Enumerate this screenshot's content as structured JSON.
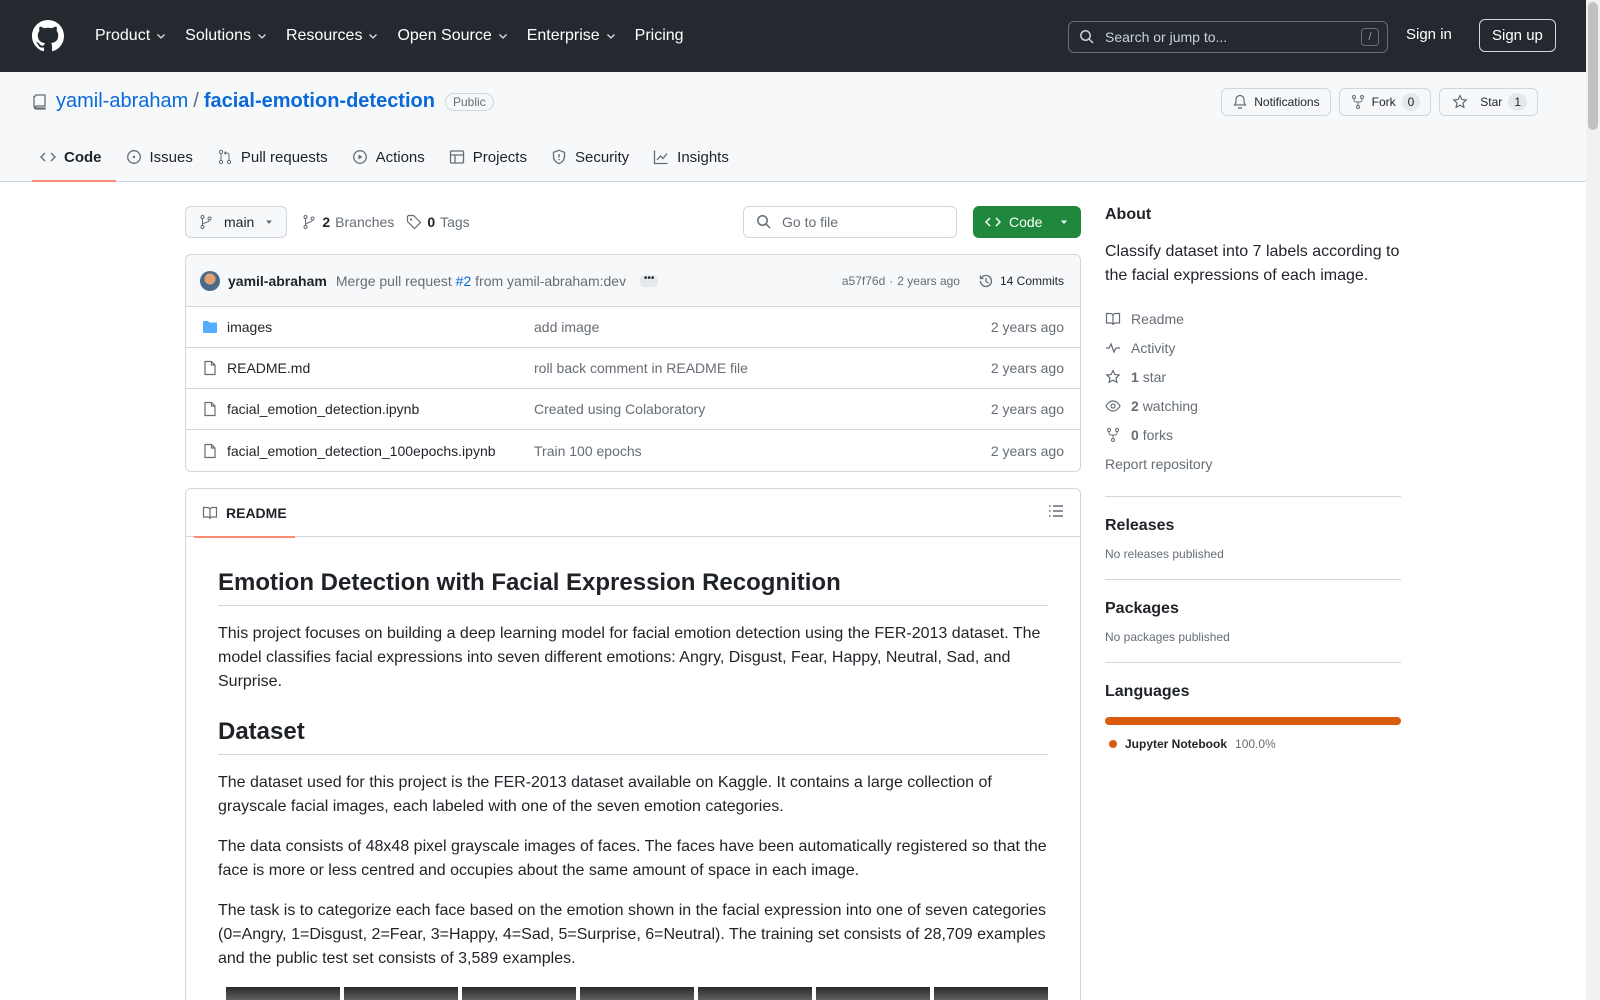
{
  "header": {
    "nav": [
      "Product",
      "Solutions",
      "Resources",
      "Open Source",
      "Enterprise",
      "Pricing"
    ],
    "search_placeholder": "Search or jump to...",
    "search_shortcut": "/",
    "sign_in": "Sign in",
    "sign_up": "Sign up"
  },
  "repo": {
    "owner": "yamil-abraham",
    "separator": "/",
    "name": "facial-emotion-detection",
    "visibility": "Public",
    "notifications_label": "Notifications",
    "fork_label": "Fork",
    "fork_count": "0",
    "star_label": "Star",
    "star_count": "1",
    "tabs": [
      "Code",
      "Issues",
      "Pull requests",
      "Actions",
      "Projects",
      "Security",
      "Insights"
    ]
  },
  "file_nav": {
    "branch": "main",
    "branches_count": "2",
    "branches_label": "Branches",
    "tags_count": "0",
    "tags_label": "Tags",
    "goto_placeholder": "Go to file",
    "code_button": "Code"
  },
  "commit": {
    "author": "yamil-abraham",
    "message_prefix": "Merge pull request",
    "pr_link": "#2",
    "message_suffix": "from yamil-abraham:dev",
    "hash": "a57f76d",
    "dot": "·",
    "age": "2 years ago",
    "commits_label": "14 Commits"
  },
  "files": [
    {
      "name": "images",
      "type": "folder",
      "message": "add image",
      "age": "2 years ago"
    },
    {
      "name": "README.md",
      "type": "file",
      "message": "roll back comment in README file",
      "age": "2 years ago"
    },
    {
      "name": "facial_emotion_detection.ipynb",
      "type": "file",
      "message": "Created using Colaboratory",
      "age": "2 years ago"
    },
    {
      "name": "facial_emotion_detection_100epochs.ipynb",
      "type": "file",
      "message": "Train 100 epochs",
      "age": "2 years ago"
    }
  ],
  "readme": {
    "tab_label": "README",
    "h1": "Emotion Detection with Facial Expression Recognition",
    "p1": "This project focuses on building a deep learning model for facial emotion detection using the FER-2013 dataset. The model classifies facial expressions into seven different emotions: Angry, Disgust, Fear, Happy, Neutral, Sad, and Surprise.",
    "h2": "Dataset",
    "p2": "The dataset used for this project is the FER-2013 dataset available on Kaggle. It contains a large collection of grayscale facial images, each labeled with one of the seven emotion categories.",
    "p3": "The data consists of 48x48 pixel grayscale images of faces. The faces have been automatically registered so that the face is more or less centred and occupies about the same amount of space in each image.",
    "p4": "The task is to categorize each face based on the emotion shown in the facial expression into one of seven categories (0=Angry, 1=Disgust, 2=Fear, 3=Happy, 4=Sad, 5=Surprise, 6=Neutral). The training set consists of 28,709 examples and the public test set consists of 3,589 examples."
  },
  "about": {
    "title": "About",
    "description": "Classify dataset into 7 labels according to the facial expressions of each image.",
    "readme": "Readme",
    "activity": "Activity",
    "stars_count": "1",
    "stars_label": "star",
    "watching_count": "2",
    "watching_label": "watching",
    "forks_count": "0",
    "forks_label": "forks",
    "report": "Report repository"
  },
  "releases": {
    "title": "Releases",
    "empty": "No releases published"
  },
  "packages": {
    "title": "Packages",
    "empty": "No packages published"
  },
  "languages": {
    "title": "Languages",
    "name": "Jupyter Notebook",
    "percent": "100.0%",
    "color": "#da5b0b"
  }
}
